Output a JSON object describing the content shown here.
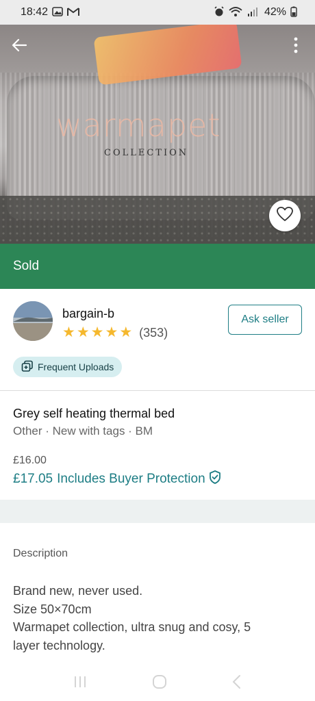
{
  "status_bar": {
    "time": "18:42",
    "left_icons": [
      "gallery-icon",
      "gmail-icon"
    ],
    "battery": "42%",
    "right_icons": [
      "alarm-icon",
      "wifi-icon",
      "signal-icon",
      "battery-icon"
    ]
  },
  "photo": {
    "brand_text": "warmapet",
    "sub_brand_text": "COLLECTION"
  },
  "colors": {
    "sold_green": "#2c8656",
    "accent_teal": "#1d7d84",
    "star": "#f5b82e",
    "badge_bg": "#d6eef0"
  },
  "sold_label": "Sold",
  "seller": {
    "name": "bargain-b",
    "stars": 5,
    "review_count": "(353)",
    "ask_button": "Ask seller"
  },
  "badge": {
    "label": "Frequent Uploads"
  },
  "item": {
    "title": "Grey self heating thermal bed",
    "meta": "Other · New with tags · BM",
    "price": "£16.00",
    "total_price": "£17.05",
    "protection_label": "Includes Buyer Protection"
  },
  "description": {
    "heading": "Description",
    "lines": [
      "Brand new, never used.",
      "Size 50×70cm",
      "Warmapet collection, ultra snug and cosy, 5",
      "layer technology."
    ]
  }
}
